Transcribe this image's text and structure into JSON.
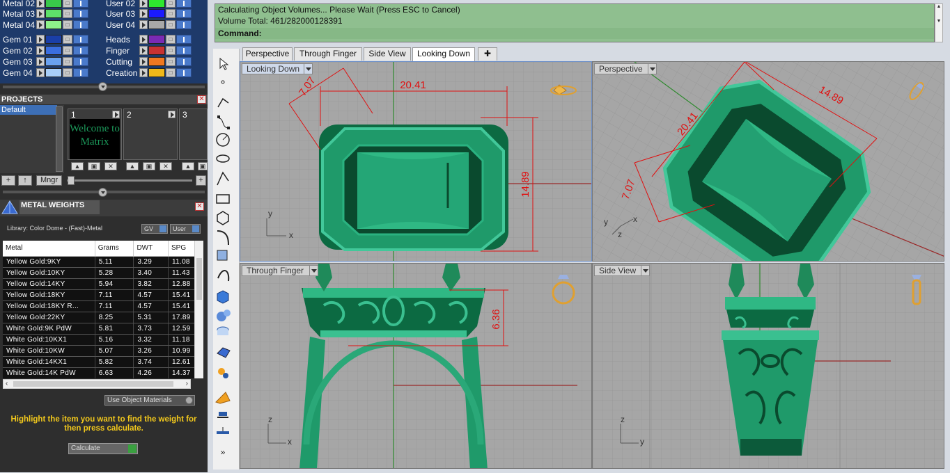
{
  "layers": {
    "left_col": [
      {
        "name": "Metal 02",
        "color": "#39c84a"
      },
      {
        "name": "Metal 03",
        "color": "#5ee06a"
      },
      {
        "name": "Metal 04",
        "color": "#8ef28a"
      },
      {
        "name": "Gem 01",
        "color": "#1a3fa8"
      },
      {
        "name": "Gem 02",
        "color": "#3a6ee0"
      },
      {
        "name": "Gem 03",
        "color": "#6aa2f0"
      },
      {
        "name": "Gem 04",
        "color": "#a8cef8"
      }
    ],
    "right_col": [
      {
        "name": "User 02",
        "color": "#2ee82e"
      },
      {
        "name": "User 03",
        "color": "#1a1aff"
      },
      {
        "name": "User 04",
        "color": "#a8a8a8"
      },
      {
        "name": "Heads",
        "color": "#7a2ab4"
      },
      {
        "name": "Finger",
        "color": "#c83232"
      },
      {
        "name": "Cutting",
        "color": "#f07820"
      },
      {
        "name": "Creation",
        "color": "#f0b81a"
      }
    ]
  },
  "projects": {
    "title": "PROJECTS",
    "items": [
      "Default"
    ],
    "slots": [
      "1",
      "2",
      "3"
    ],
    "welcome_text": "Welcome to Matrix",
    "manager_label": "Mngr"
  },
  "metal_weights": {
    "title": "METAL WEIGHTS",
    "library": "Library: Color Dome - (Fast)-Metal",
    "gv_label": "GV",
    "user_label": "User",
    "columns": [
      "Metal",
      "Grams",
      "DWT",
      "SPG"
    ],
    "rows": [
      [
        "Yellow Gold:9KY",
        "5.11",
        "3.29",
        "11.08"
      ],
      [
        "Yellow Gold:10KY",
        "5.28",
        "3.40",
        "11.43"
      ],
      [
        "Yellow Gold:14KY",
        "5.94",
        "3.82",
        "12.88"
      ],
      [
        "Yellow Gold:18KY",
        "7.11",
        "4.57",
        "15.41"
      ],
      [
        "Yellow Gold:18KY R...",
        "7.11",
        "4.57",
        "15.41"
      ],
      [
        "Yellow Gold:22KY",
        "8.25",
        "5.31",
        "17.89"
      ],
      [
        "White Gold:9K PdW",
        "5.81",
        "3.73",
        "12.59"
      ],
      [
        "White Gold:10KX1",
        "5.16",
        "3.32",
        "11.18"
      ],
      [
        "White Gold:10KW",
        "5.07",
        "3.26",
        "10.99"
      ],
      [
        "White Gold:14KX1",
        "5.82",
        "3.74",
        "12.61"
      ],
      [
        "White Gold:14K PdW",
        "6.63",
        "4.26",
        "14.37"
      ]
    ],
    "material_select": "Use Object Materials",
    "hint": "Highlight the item you want to find the weight for then press calculate.",
    "calculate_label": "Calculate"
  },
  "command": {
    "line1": "Calculating Object Volumes... Please Wait (Press ESC to Cancel)",
    "line2": "Volume Total: 461/282000128391",
    "prompt": "Command:"
  },
  "tabs": [
    "Perspective",
    "Through Finger",
    "Side View",
    "Looking Down"
  ],
  "active_tab": "Looking Down",
  "viewports": {
    "top_left": {
      "label": "Looking Down",
      "dims": [
        "20.41",
        "7.07",
        "14.89"
      ],
      "axes": [
        "y",
        "x"
      ]
    },
    "top_right": {
      "label": "Perspective",
      "dims": [
        "20.41",
        "14.89",
        "7.07"
      ],
      "axes": [
        "y",
        "z",
        "x"
      ]
    },
    "bottom_left": {
      "label": "Through Finger",
      "dims": [
        "6.36"
      ],
      "axes": [
        "z",
        "x"
      ]
    },
    "bottom_right": {
      "label": "Side View",
      "axes": [
        "z",
        "y"
      ]
    }
  },
  "colors": {
    "ring_green": "#1f9a6a",
    "dimension_red": "#e01010",
    "command_bg": "#8fbf8f",
    "hint_yellow": "#f2c81c"
  }
}
